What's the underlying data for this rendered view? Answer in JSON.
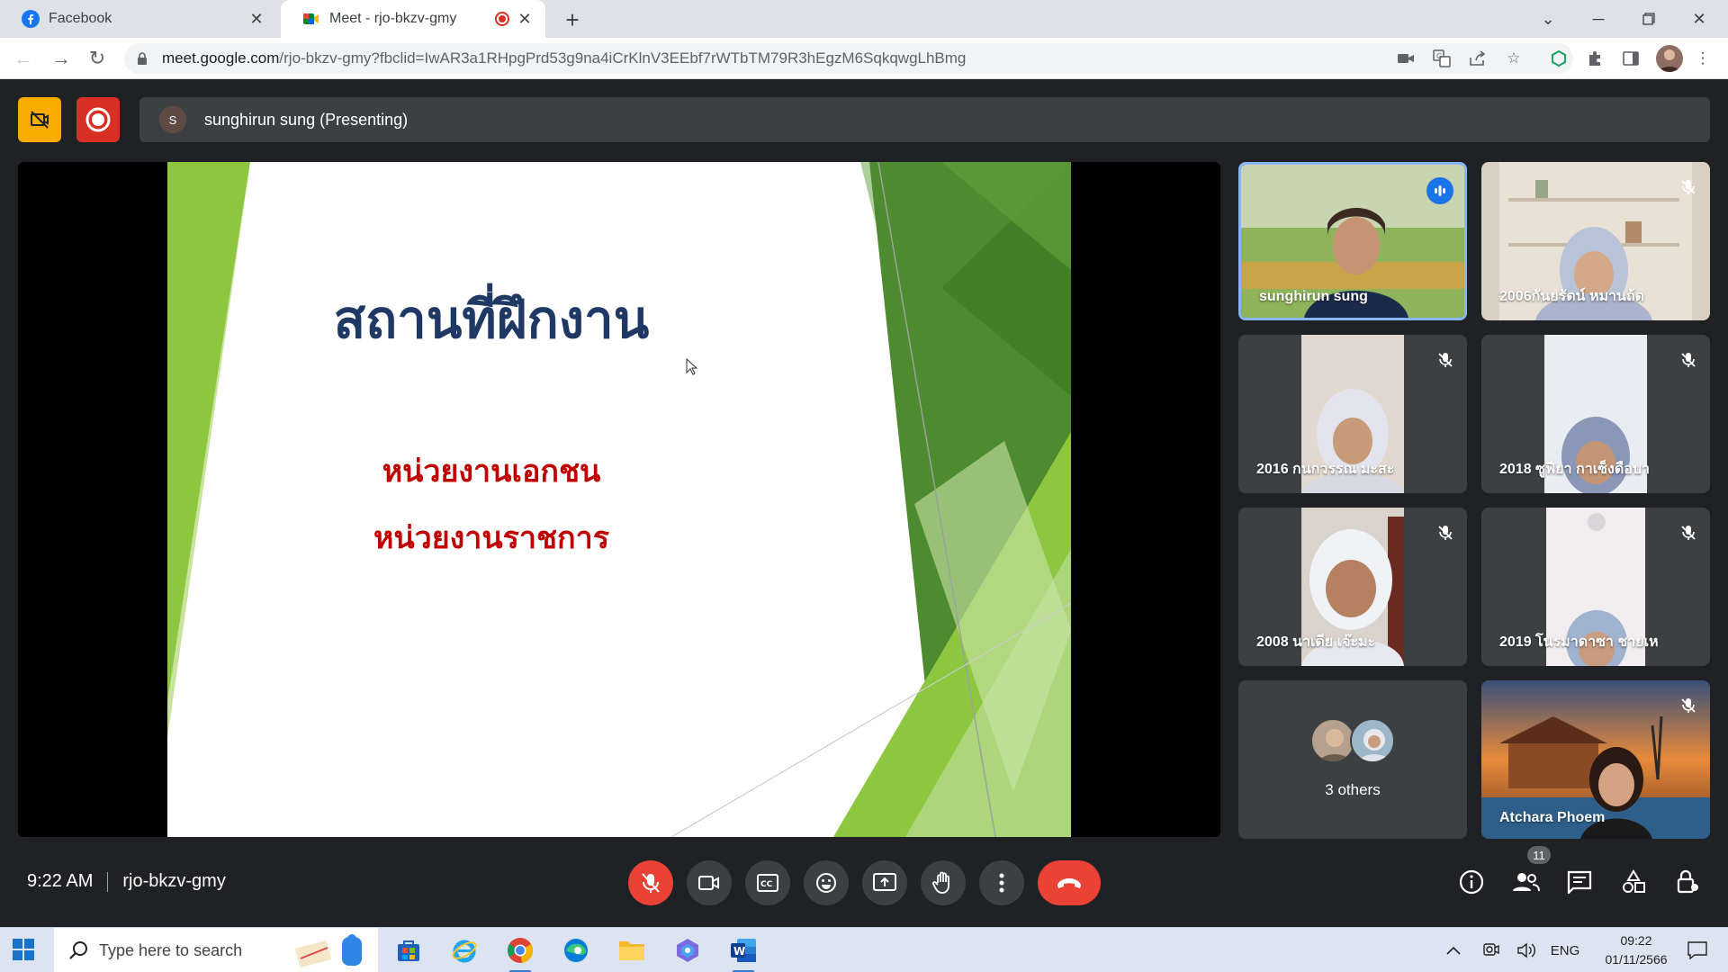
{
  "browser": {
    "tabs": [
      {
        "title": "Facebook",
        "active": false
      },
      {
        "title": "Meet - rjo-bkzv-gmy",
        "active": true
      }
    ],
    "url_host": "meet.google.com",
    "url_path": "/rjo-bkzv-gmy?fbclid=IwAR3a1RHpgPrd53g9na4iCrKlnV3EEbf7rWTbTM79R3hEgzM6SqkqwgLhBmg"
  },
  "meet": {
    "presenter_initial": "S",
    "presenting_label": "sunghirun sung (Presenting)",
    "slide": {
      "title": "สถานที่ฝึกงาน",
      "lines": [
        "หน่วยงานเอกชน",
        "หน่วยงานราชการ"
      ]
    },
    "participants": [
      {
        "name": "sunghirun sung",
        "speaking": true
      },
      {
        "name": "2006กันยรัตน์ หมานถ้ด",
        "muted": true
      },
      {
        "name": "2016 กนกวรรณ มะสะ",
        "muted": true
      },
      {
        "name": "2018 ซูฟียา กาเซ็งดือบา",
        "muted": true
      },
      {
        "name": "2008 นาเดีย เจ๊ะมะ",
        "muted": true
      },
      {
        "name": "2019 โนรมาดาซา ชายเห",
        "muted": true
      },
      {
        "name": "3 others"
      },
      {
        "name": "Atchara Phoem",
        "muted": true
      }
    ],
    "time": "9:22 AM",
    "meeting_code": "rjo-bkzv-gmy",
    "people_count": "11"
  },
  "taskbar": {
    "search_placeholder": "Type here to search",
    "lang": "ENG",
    "time": "09:22",
    "date": "01/11/2566"
  },
  "colors": {
    "meet_bg": "#202124",
    "tile_bg": "#3c4043",
    "danger": "#ea4335",
    "accent": "#1a73e8",
    "slide_title": "#1f3864",
    "slide_text": "#c00000"
  }
}
